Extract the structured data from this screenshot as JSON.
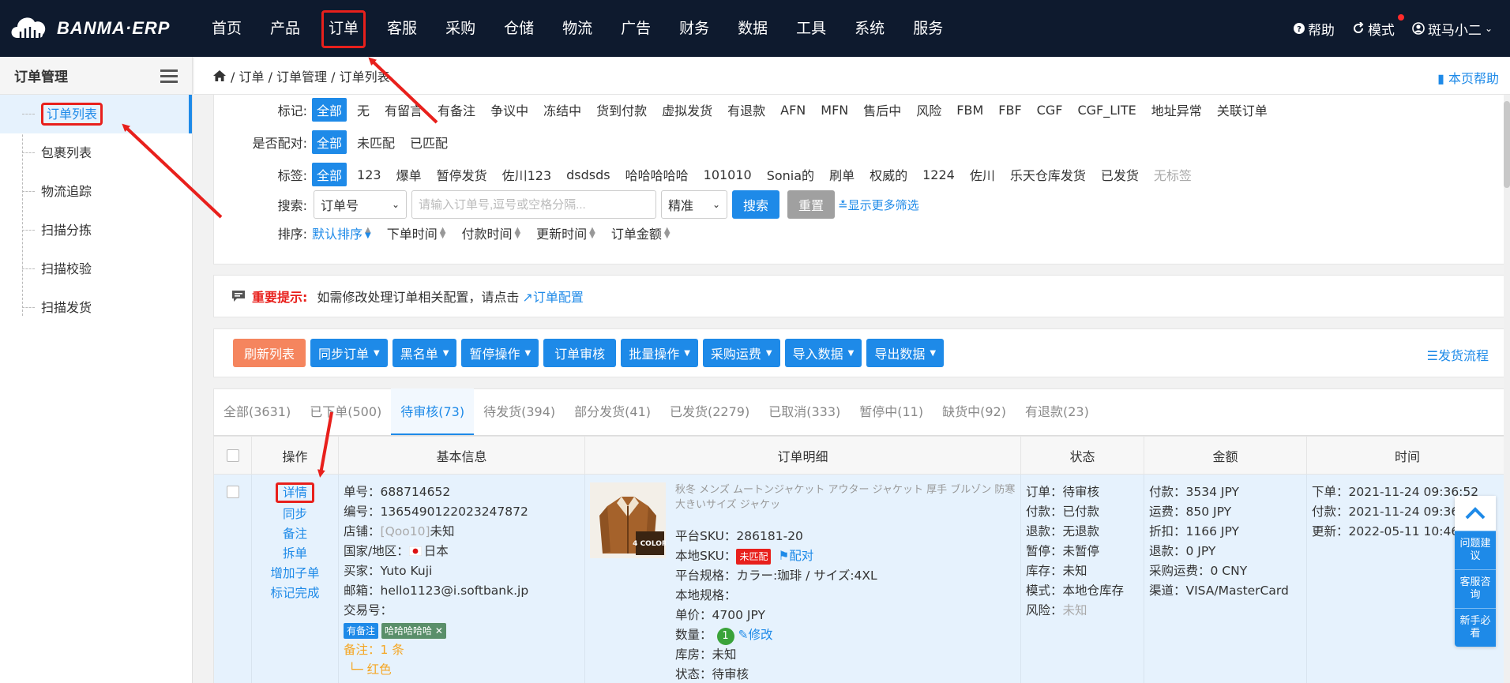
{
  "app": {
    "logo_text": "BANMA·ERP"
  },
  "nav": {
    "items": [
      {
        "label": "首页"
      },
      {
        "label": "产品"
      },
      {
        "label": "订单"
      },
      {
        "label": "客服"
      },
      {
        "label": "采购"
      },
      {
        "label": "仓储"
      },
      {
        "label": "物流"
      },
      {
        "label": "广告"
      },
      {
        "label": "财务"
      },
      {
        "label": "数据"
      },
      {
        "label": "工具"
      },
      {
        "label": "系统"
      },
      {
        "label": "服务"
      }
    ],
    "help": "帮助",
    "mode": "模式",
    "user": "斑马小二"
  },
  "sidebar": {
    "title": "订单管理",
    "items": [
      {
        "label": "订单列表"
      },
      {
        "label": "包裹列表"
      },
      {
        "label": "物流追踪"
      },
      {
        "label": "扫描分拣"
      },
      {
        "label": "扫描校验"
      },
      {
        "label": "扫描发货"
      }
    ]
  },
  "breadcrumb": {
    "path": "/ 订单 / 订单管理 / 订单列表",
    "page_help": "本页帮助"
  },
  "filters": {
    "mark": {
      "label": "标记:",
      "chips": [
        "全部",
        "无",
        "有留言",
        "有备注",
        "争议中",
        "冻结中",
        "货到付款",
        "虚拟发货",
        "有退款",
        "AFN",
        "MFN",
        "售后中",
        "风险",
        "FBM",
        "FBF",
        "CGF",
        "CGF_LITE",
        "地址异常",
        "关联订单"
      ]
    },
    "matched": {
      "label": "是否配对:",
      "chips": [
        "全部",
        "未匹配",
        "已匹配"
      ]
    },
    "tags": {
      "label": "标签:",
      "chips": [
        "全部",
        "123",
        "爆单",
        "暂停发货",
        "佐川123",
        "dsdsds",
        "哈哈哈哈哈",
        "101010",
        "Sonia的",
        "刷单",
        "权威的",
        "1224",
        "佐川",
        "乐天仓库发货",
        "已发货",
        "无标签"
      ]
    },
    "search": {
      "label": "搜索:",
      "field": "订单号",
      "placeholder": "请输入订单号,逗号或空格分隔...",
      "mode": "精准",
      "search_btn": "搜索",
      "reset_btn": "重置",
      "more": "显示更多筛选"
    },
    "sort": {
      "label": "排序:",
      "items": [
        "默认排序",
        "下单时间",
        "付款时间",
        "更新时间",
        "订单金额"
      ]
    }
  },
  "notice": {
    "important": "重要提示:",
    "text": "如需修改处理订单相关配置，请点击",
    "link": "订单配置"
  },
  "actions": {
    "refresh": "刷新列表",
    "buttons": [
      "同步订单",
      "黑名单",
      "暂停操作",
      "订单审核",
      "批量操作",
      "采购运费",
      "导入数据",
      "导出数据"
    ],
    "flow": "发货流程"
  },
  "tabs": [
    {
      "label": "全部(3631)"
    },
    {
      "label": "已下单(500)"
    },
    {
      "label": "待审核(73)"
    },
    {
      "label": "待发货(394)"
    },
    {
      "label": "部分发货(41)"
    },
    {
      "label": "已发货(2279)"
    },
    {
      "label": "已取消(333)"
    },
    {
      "label": "暂停中(11)"
    },
    {
      "label": "缺货中(92)"
    },
    {
      "label": "有退款(23)"
    }
  ],
  "table": {
    "headers": [
      "操作",
      "基本信息",
      "订单明细",
      "状态",
      "金额",
      "时间"
    ],
    "row": {
      "ops": [
        "详情",
        "同步",
        "备注",
        "拆单",
        "增加子单",
        "标记完成"
      ],
      "basic": {
        "order_no": "单号：688714652",
        "serial": "编号：1365490122023247872",
        "shop_prefix": "店铺：",
        "shop_muted": "[Qoo10]",
        "shop_suffix": "未知",
        "country_prefix": "国家/地区：",
        "country": "日本",
        "buyer": "买家：Yuto Kuji",
        "email": "邮箱：hello1123@i.softbank.jp",
        "trade": "交易号：",
        "tag1": "有备注",
        "tag2": "哈哈哈哈哈",
        "note": "备注：1 条",
        "note_item": "红色"
      },
      "detail": {
        "title": "秋冬 メンズ ムートンジャケット アウター ジャケット 厚手 ブルゾン 防寒 大きいサイズ ジャケッ",
        "image_caption": "4 COLOR",
        "platform_sku": "平台SKU：286181-20",
        "local_sku_label": "本地SKU：",
        "unmatched": "未匹配",
        "pair": "配对",
        "platform_spec": "平台规格：カラー:珈琲 / サイズ:4XL",
        "local_spec": "本地规格：",
        "unit_price": "单价：4700 JPY",
        "qty_label": "数量：",
        "qty": "1",
        "modify": "修改",
        "room": "库房：未知",
        "status": "状态：待审核"
      },
      "status": {
        "order": "订单：待审核",
        "pay": "付款：已付款",
        "refund": "退款：无退款",
        "pause": "暂停：未暂停",
        "stock": "库存：未知",
        "mode": "模式：本地仓库存",
        "risk_label": "风险：",
        "risk": "未知"
      },
      "amount": {
        "paid": "付款：3534 JPY",
        "shipping": "运费：850 JPY",
        "discount": "折扣：1166 JPY",
        "refund": "退款：0 JPY",
        "purchase_shipping": "采购运费：0 CNY",
        "channel": "渠道：VISA/MasterCard"
      },
      "time": {
        "ordered": "下单：2021-11-24 09:36:52",
        "paid": "付款：2021-11-24 09:36:52",
        "updated": "更新：2022-05-11 10:46:05"
      }
    }
  },
  "float_help": {
    "items": [
      "问题建议",
      "客服咨询",
      "新手必看"
    ]
  },
  "colors": {
    "topbar": "#0e1a2e",
    "accent": "#1e8ae8",
    "annotation": "#e8201c",
    "refresh": "#f5855e"
  }
}
